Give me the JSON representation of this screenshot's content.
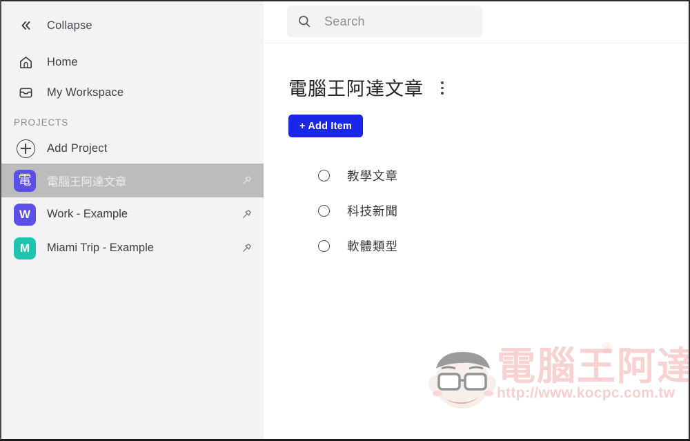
{
  "sidebar": {
    "collapse": {
      "label": "Collapse",
      "icon": "double-chevron-left-icon"
    },
    "nav": [
      {
        "label": "Home",
        "icon": "home-icon"
      },
      {
        "label": "My Workspace",
        "icon": "inbox-icon"
      }
    ],
    "section_label": "PROJECTS",
    "add_project": {
      "label": "Add Project",
      "icon": "plus-circle-icon"
    },
    "projects": [
      {
        "badge": "電",
        "label": "電腦王阿達文章",
        "badge_color": "#5b4fe8",
        "selected": true,
        "pin_icon": "pin-icon"
      },
      {
        "badge": "W",
        "label": "Work - Example",
        "badge_color": "#5b4fe8",
        "selected": false,
        "pin_icon": "pin-icon"
      },
      {
        "badge": "M",
        "label": "Miami Trip - Example",
        "badge_color": "#1ec4b0",
        "selected": false,
        "pin_icon": "pin-icon"
      }
    ]
  },
  "topbar": {
    "search": {
      "icon": "search-icon",
      "placeholder": "Search",
      "value": ""
    }
  },
  "main": {
    "title": "電腦王阿達文章",
    "menu_icon": "kebab-vertical-icon",
    "add_item_label": "+ Add Item",
    "accent_color": "#1a26e8",
    "tasks": [
      {
        "label": "教學文章",
        "checked": false
      },
      {
        "label": "科技新聞",
        "checked": false
      },
      {
        "label": "軟體類型",
        "checked": false
      }
    ]
  },
  "watermark": {
    "brand": "電腦王阿達",
    "url": "http://www.kocpc.com.tw",
    "color": "#e86a6a"
  }
}
